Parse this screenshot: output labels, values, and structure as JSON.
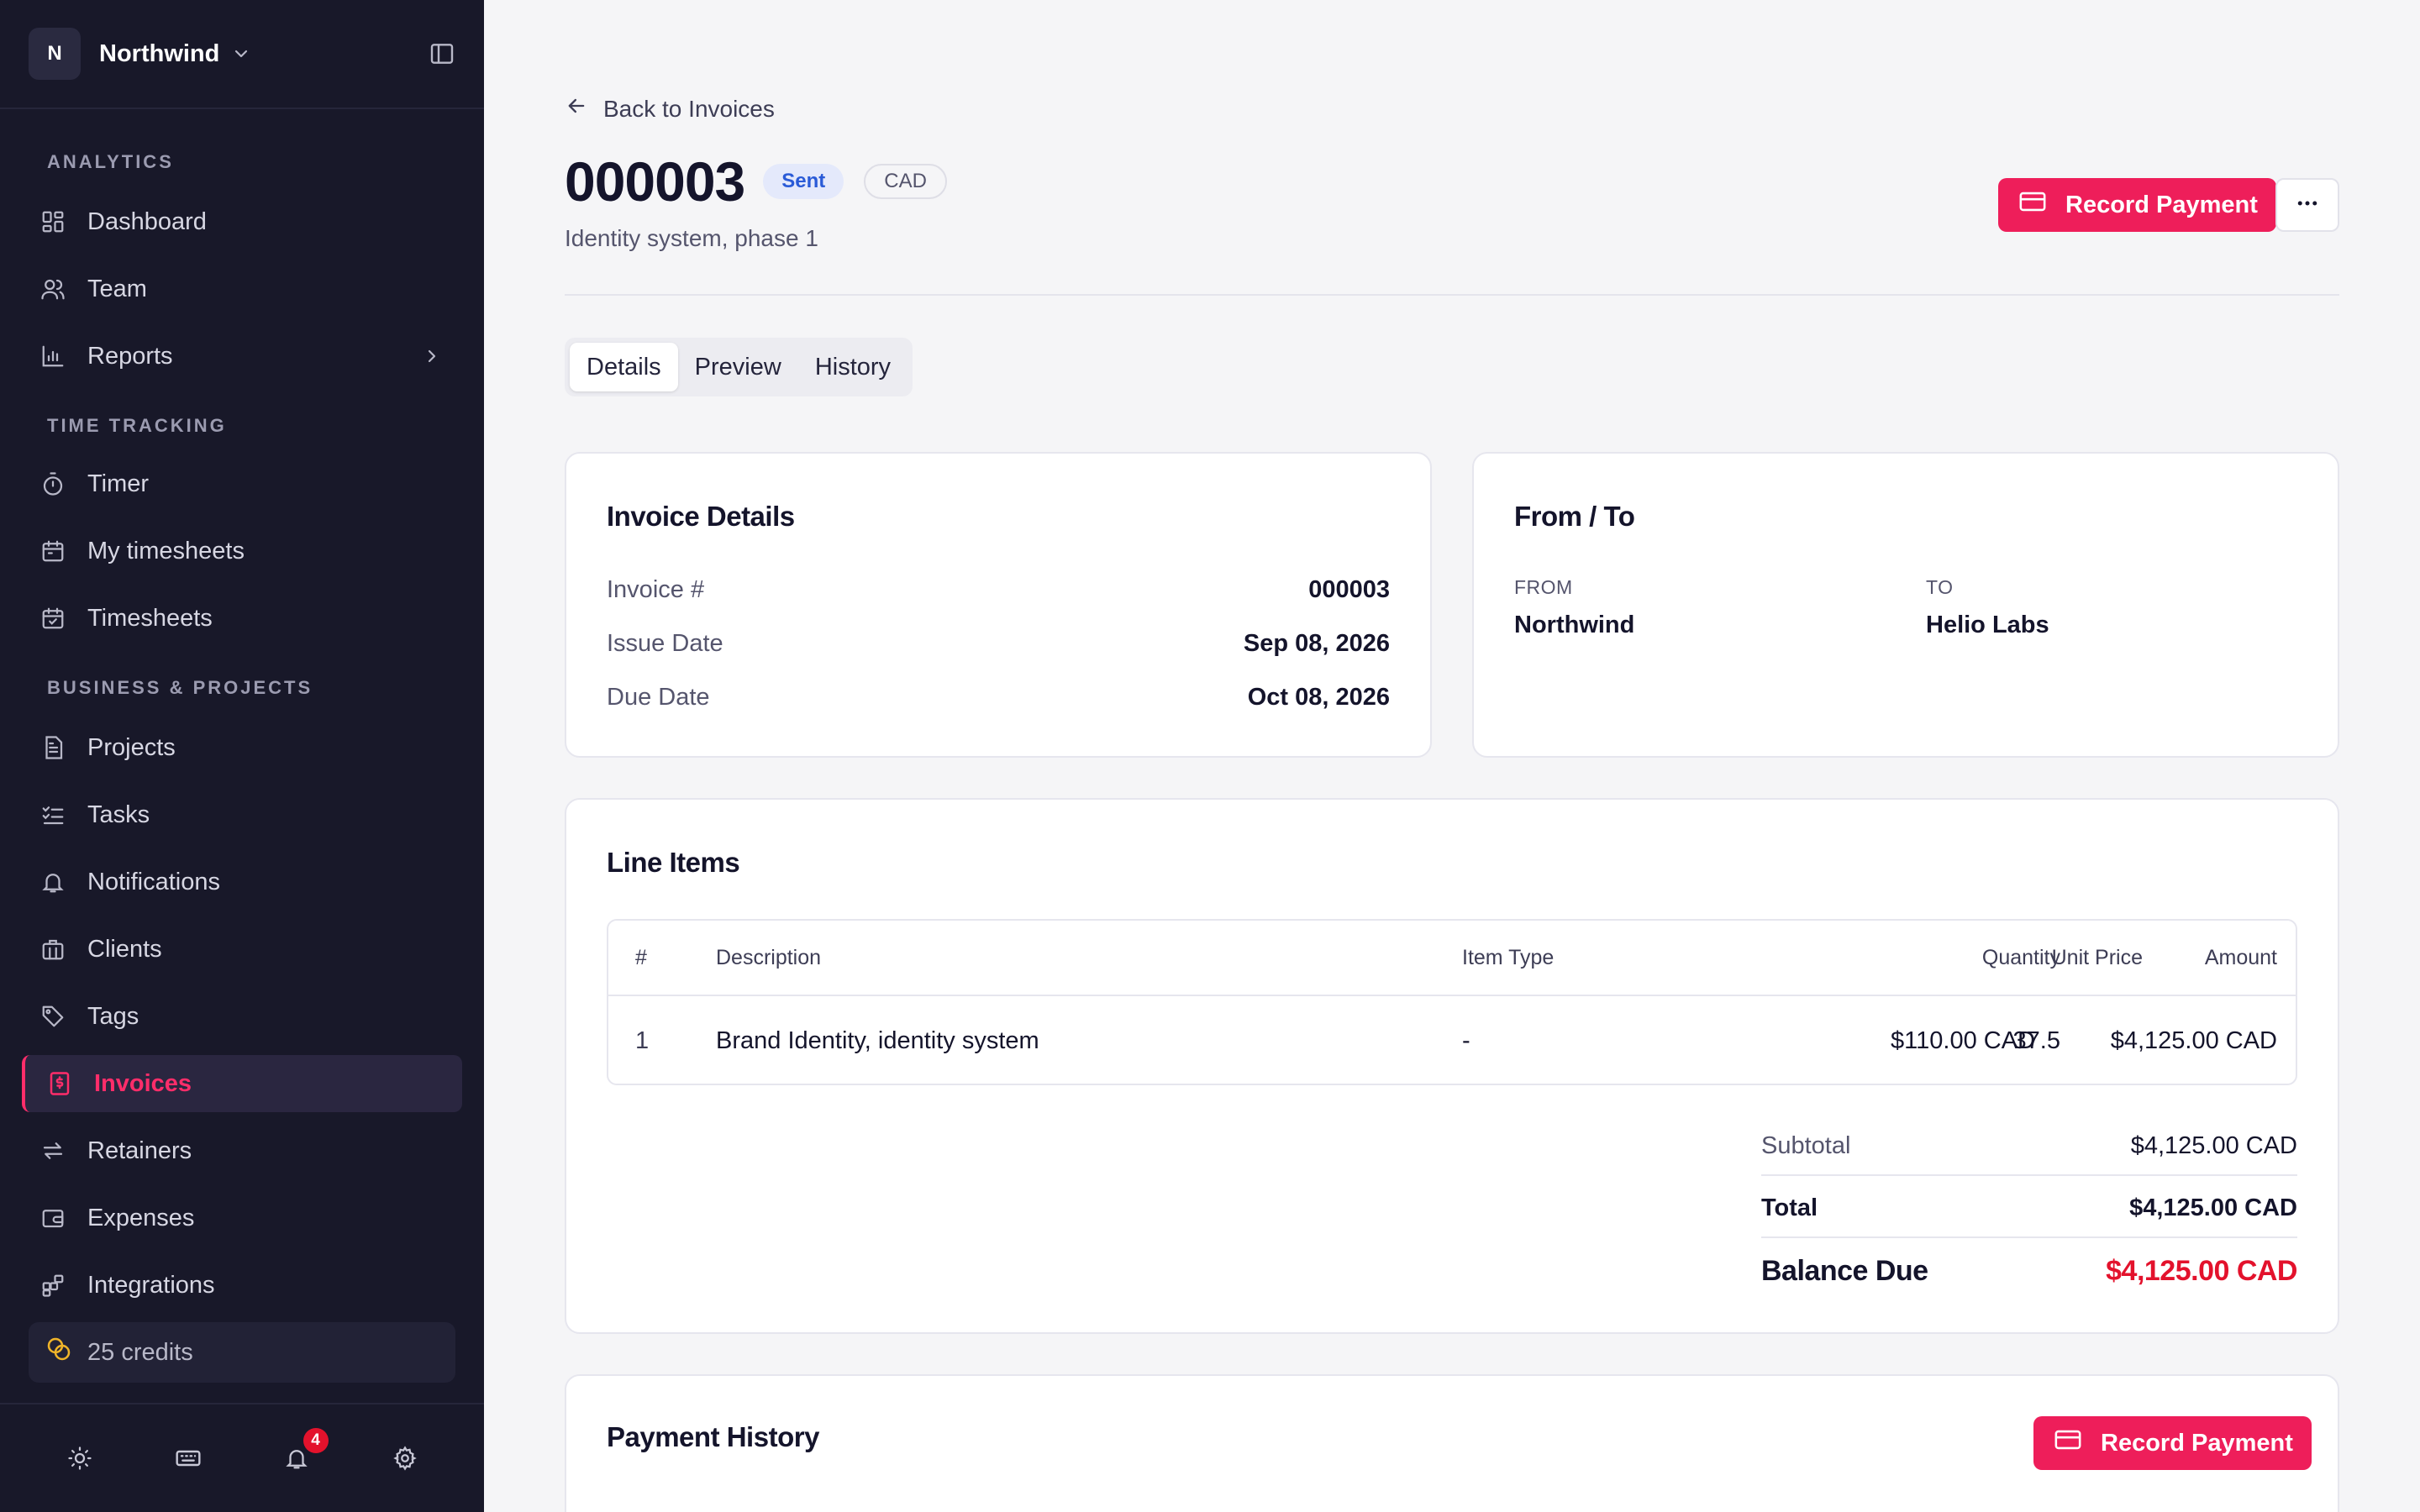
{
  "workspace": {
    "initial": "N",
    "name": "Northwind"
  },
  "sidebar": {
    "sections": {
      "analytics": "ANALYTICS",
      "time_tracking": "TIME TRACKING",
      "business": "BUSINESS & PROJECTS"
    },
    "items": [
      {
        "label": "Dashboard",
        "icon": "dashboard-icon"
      },
      {
        "label": "Team",
        "icon": "team-icon"
      },
      {
        "label": "Reports",
        "icon": "reports-icon"
      },
      {
        "label": "Timer",
        "icon": "timer-icon"
      },
      {
        "label": "My timesheets",
        "icon": "calendar-icon"
      },
      {
        "label": "Timesheets",
        "icon": "calendar-check-icon"
      },
      {
        "label": "Projects",
        "icon": "document-icon"
      },
      {
        "label": "Tasks",
        "icon": "checklist-icon"
      },
      {
        "label": "Notifications",
        "icon": "bell-icon"
      },
      {
        "label": "Clients",
        "icon": "briefcase-icon"
      },
      {
        "label": "Tags",
        "icon": "tag-icon"
      },
      {
        "label": "Invoices",
        "icon": "invoice-icon",
        "active": true
      },
      {
        "label": "Retainers",
        "icon": "repeat-icon"
      },
      {
        "label": "Expenses",
        "icon": "wallet-icon"
      },
      {
        "label": "Integrations",
        "icon": "integrations-icon"
      }
    ],
    "credits": "25 credits",
    "notification_count": "4"
  },
  "page": {
    "back_label": "Back to Invoices",
    "invoice_number": "000003",
    "status": "Sent",
    "currency": "CAD",
    "subtitle": "Identity system, phase 1",
    "record_payment_label": "Record Payment",
    "tabs": [
      "Details",
      "Preview",
      "History"
    ],
    "active_tab": "Details"
  },
  "invoice_details": {
    "title": "Invoice Details",
    "rows": [
      {
        "label": "Invoice #",
        "value": "000003"
      },
      {
        "label": "Issue Date",
        "value": "Sep 08, 2026"
      },
      {
        "label": "Due Date",
        "value": "Oct 08, 2026"
      }
    ]
  },
  "from_to": {
    "title": "From / To",
    "from_label": "FROM",
    "from_value": "Northwind",
    "to_label": "TO",
    "to_value": "Helio Labs"
  },
  "line_items": {
    "title": "Line Items",
    "headers": [
      "#",
      "Description",
      "Item Type",
      "Quantity",
      "Unit Price",
      "Amount"
    ],
    "rows": [
      {
        "num": "1",
        "description": "Brand Identity, identity system",
        "type": "-",
        "quantity": "37.5",
        "unit_price": "$110.00 CAD",
        "amount": "$4,125.00 CAD"
      }
    ],
    "subtotal_label": "Subtotal",
    "subtotal": "$4,125.00 CAD",
    "total_label": "Total",
    "total": "$4,125.00 CAD",
    "balance_label": "Balance Due",
    "balance": "$4,125.00 CAD"
  },
  "payment_history": {
    "title": "Payment History",
    "button_label": "Record Payment"
  },
  "colors": {
    "accent": "#ee1e5a",
    "balance_red": "#e3122c",
    "sidebar_bg": "#181829",
    "sent_badge": "#2a5bd7"
  }
}
